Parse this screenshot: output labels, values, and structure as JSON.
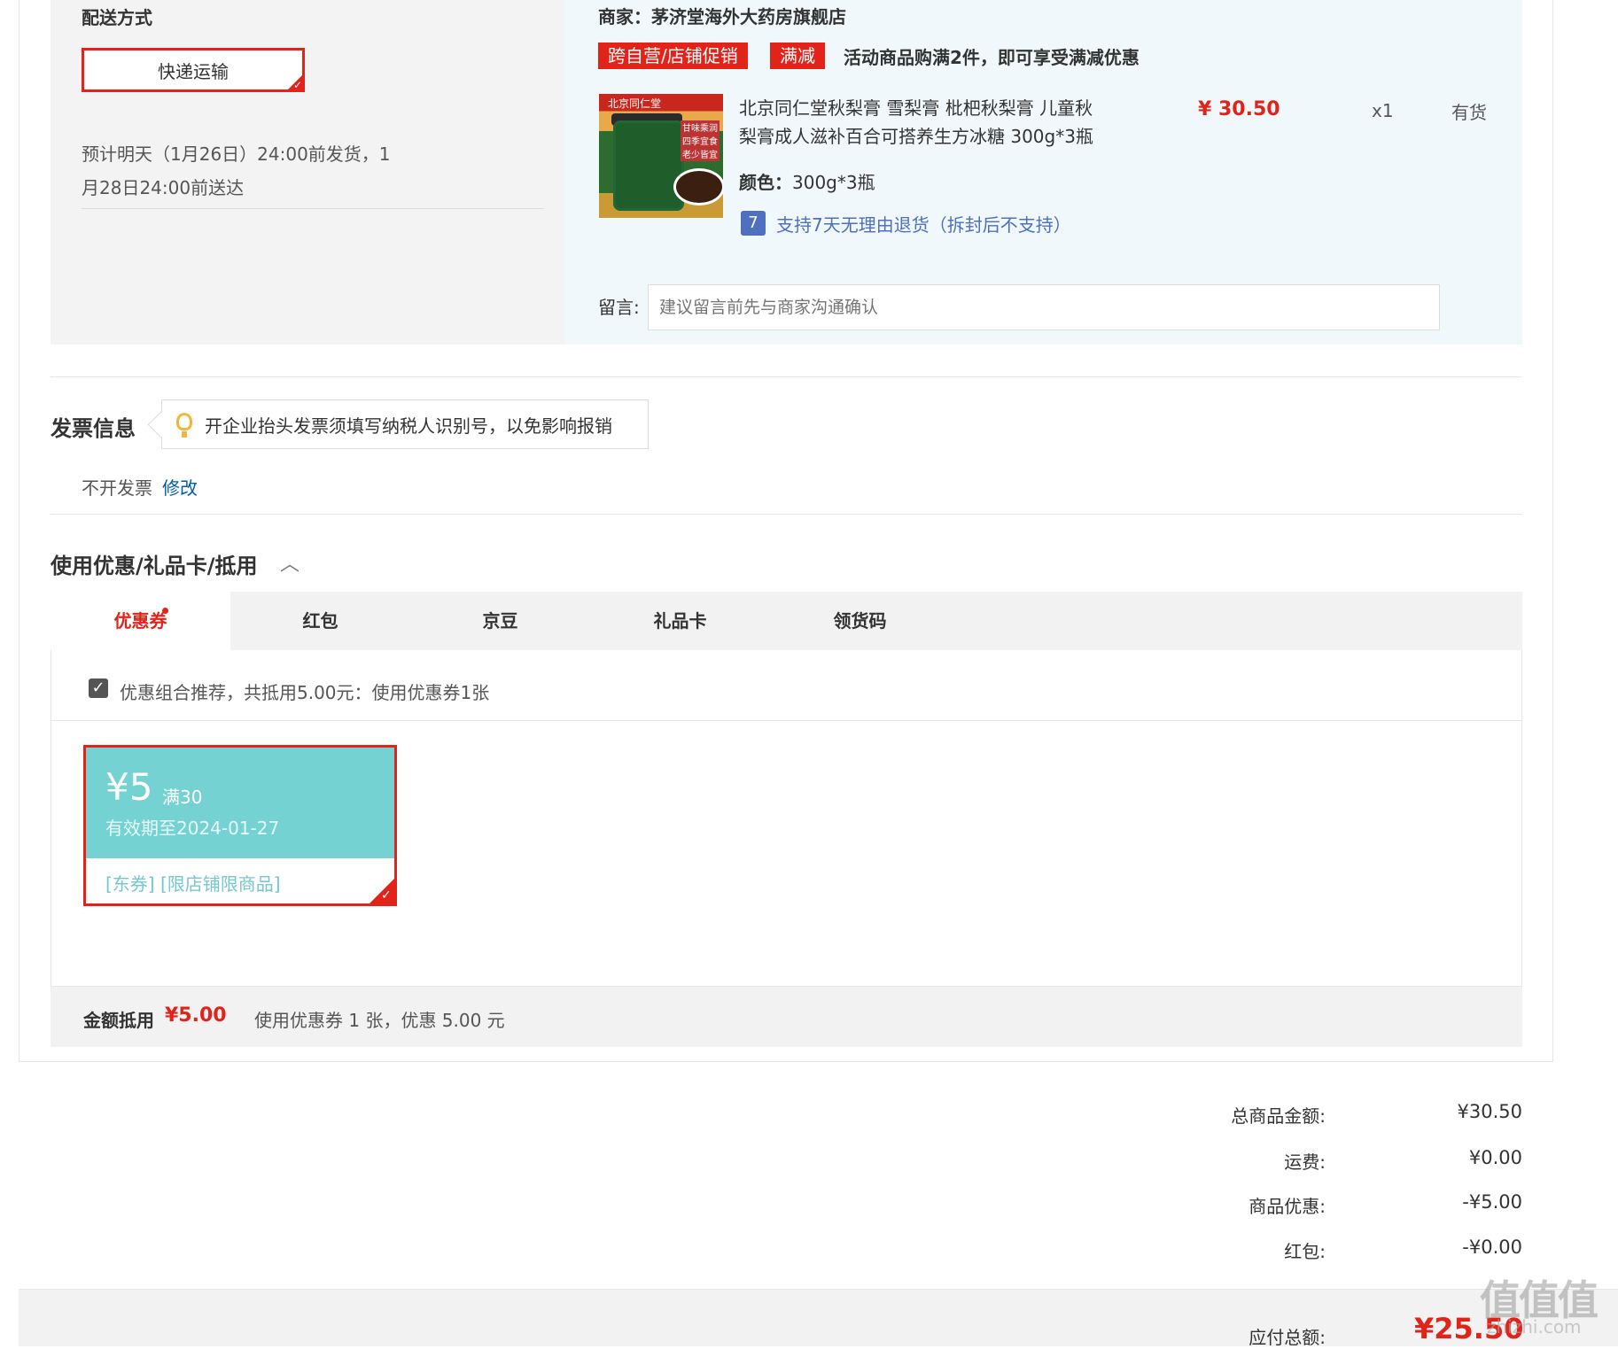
{
  "shipping": {
    "title": "配送方式",
    "method": "快递运输",
    "eta_line1": "预计明天（1月26日）24:00前发货，1",
    "eta_line2": "月28日24:00前送达"
  },
  "store": {
    "label": "商家：茅济堂海外大药房旗舰店",
    "tag1": "跨自营/店铺促销",
    "tag2": "满减",
    "promo": "活动商品购满2件，即可享受满减优惠"
  },
  "product": {
    "name_line1": "北京同仁堂秋梨膏 雪梨膏 枇杷秋梨膏 儿童秋",
    "name_line2": "梨膏成人滋补百合可搭养生方冰糖 300g*3瓶",
    "color_label": "颜色：",
    "color_value": "300g*3瓶",
    "price": "¥ 30.50",
    "quantity": "x1",
    "stock": "有货",
    "return_policy": "支持7天无理由退货（拆封后不支持）",
    "return_icon_text": "7",
    "image_brand": "北京同仁堂",
    "image_side_text": "甘味乘润 四季宜食 老少皆宜"
  },
  "note": {
    "label": "留言:",
    "placeholder": "建议留言前先与商家沟通确认"
  },
  "invoice": {
    "title": "发票信息",
    "tip": "开企业抬头发票须填写纳税人识别号，以免影响报销",
    "status": "不开发票",
    "edit": "修改"
  },
  "discount": {
    "title": "使用优惠/礼品卡/抵用",
    "tabs": [
      {
        "label": "优惠券"
      },
      {
        "label": "红包"
      },
      {
        "label": "京豆"
      },
      {
        "label": "礼品卡"
      },
      {
        "label": "领货码"
      }
    ],
    "recommend": "优惠组合推荐，共抵用5.00元：使用优惠券1张",
    "coupon": {
      "amount": "¥5",
      "condition": "满30",
      "expiry": "有效期至2024-01-27",
      "tags": "[东券]  [限店铺限商品]"
    },
    "deduct_label": "金额抵用",
    "deduct_value": "¥5.00",
    "deduct_desc": "使用优惠券 1 张，优惠 5.00 元"
  },
  "totals": {
    "goods_label": "总商品金额:",
    "goods_value": "¥30.50",
    "shipping_label": "运费:",
    "shipping_value": "¥0.00",
    "discount_label": "商品优惠:",
    "discount_value": "-¥5.00",
    "redpacket_label": "红包:",
    "redpacket_value": "-¥0.00",
    "payable_label": "应付总额:",
    "payable_value": "¥25.50"
  },
  "watermark": {
    "glyphs": "值值值",
    "site": "zhizhi.com"
  },
  "colors": {
    "accent": "#e2231a",
    "coupon": "#74d2d3",
    "link": "#005ea7"
  }
}
